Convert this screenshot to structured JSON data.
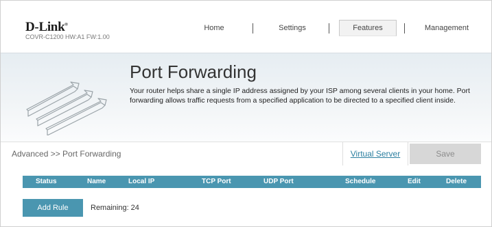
{
  "header": {
    "logo": "D-Link",
    "model": "COVR-C1200 HW:A1 FW:1.00",
    "nav": [
      {
        "label": "Home"
      },
      {
        "label": "Settings"
      },
      {
        "label": "Features",
        "active": true
      },
      {
        "label": "Management"
      }
    ]
  },
  "banner": {
    "title": "Port Forwarding",
    "description": "Your router helps share a single IP address assigned by your ISP among several clients in your home. Port forwarding allows traffic requests from a specified application to be directed to a specified client inside."
  },
  "crumb": {
    "breadcrumb": "Advanced >> Port Forwarding",
    "virtual_server_link": "Virtual Server",
    "save_label": "Save"
  },
  "table": {
    "columns": [
      "Status",
      "Name",
      "Local IP",
      "TCP Port",
      "UDP Port",
      "Schedule",
      "Edit",
      "Delete"
    ]
  },
  "footer": {
    "add_rule_label": "Add Rule",
    "remaining_label": "Remaining:",
    "remaining_count": "24"
  },
  "colors": {
    "accent": "#4a96b0",
    "link": "#2b7fa0",
    "save_disabled_bg": "#d7d7d7"
  }
}
